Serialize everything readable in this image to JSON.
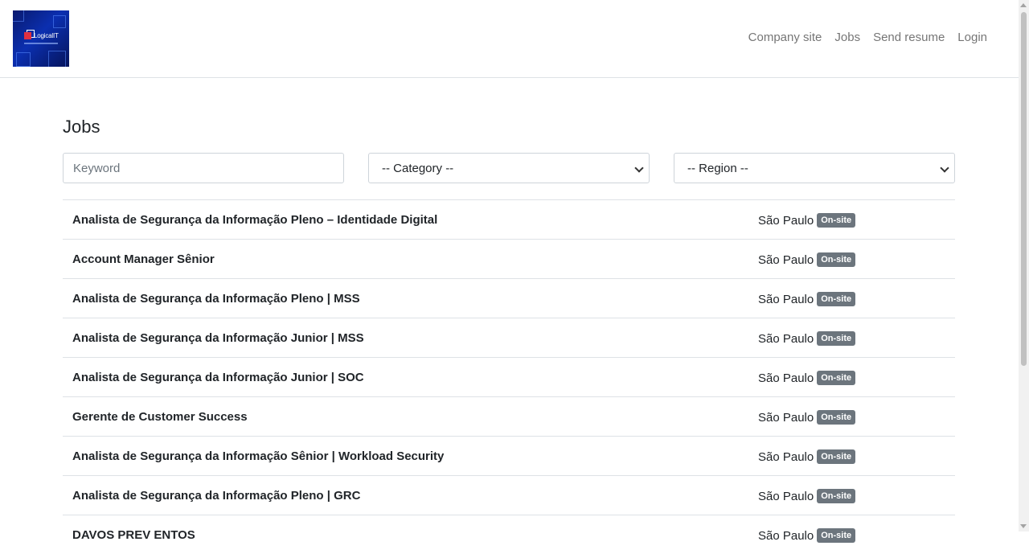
{
  "header": {
    "logo": {
      "brand_text": "LogicalIT",
      "tagline": ""
    },
    "nav": [
      {
        "label": "Company site"
      },
      {
        "label": "Jobs"
      },
      {
        "label": "Send resume"
      },
      {
        "label": "Login"
      }
    ]
  },
  "main": {
    "title": "Jobs",
    "filters": {
      "keyword_placeholder": "Keyword",
      "category_selected": "-- Category --",
      "region_selected": "-- Region --"
    },
    "jobs": [
      {
        "title": "Analista de Segurança da Informação Pleno – Identidade Digital",
        "location": "São Paulo",
        "mode": "On-site"
      },
      {
        "title": "Account Manager Sênior",
        "location": "São Paulo",
        "mode": "On-site"
      },
      {
        "title": "Analista de Segurança da Informação Pleno | MSS",
        "location": "São Paulo",
        "mode": "On-site"
      },
      {
        "title": "Analista de Segurança da Informação Junior | MSS",
        "location": "São Paulo",
        "mode": "On-site"
      },
      {
        "title": "Analista de Segurança da Informação Junior | SOC",
        "location": "São Paulo",
        "mode": "On-site"
      },
      {
        "title": "Gerente de Customer Success",
        "location": "São Paulo",
        "mode": "On-site"
      },
      {
        "title": "Analista de Segurança da Informação Sênior | Workload Security",
        "location": "São Paulo",
        "mode": "On-site"
      },
      {
        "title": "Analista de Segurança da Informação Pleno | GRC",
        "location": "São Paulo",
        "mode": "On-site"
      },
      {
        "title": "DAVOS PREV ENTOS",
        "location": "São Paulo",
        "mode": "On-site"
      }
    ]
  },
  "colors": {
    "badge_bg": "#6c757d",
    "nav_text": "rgba(0,0,0,0.55)",
    "logo_bg": "#0b2fb0"
  }
}
